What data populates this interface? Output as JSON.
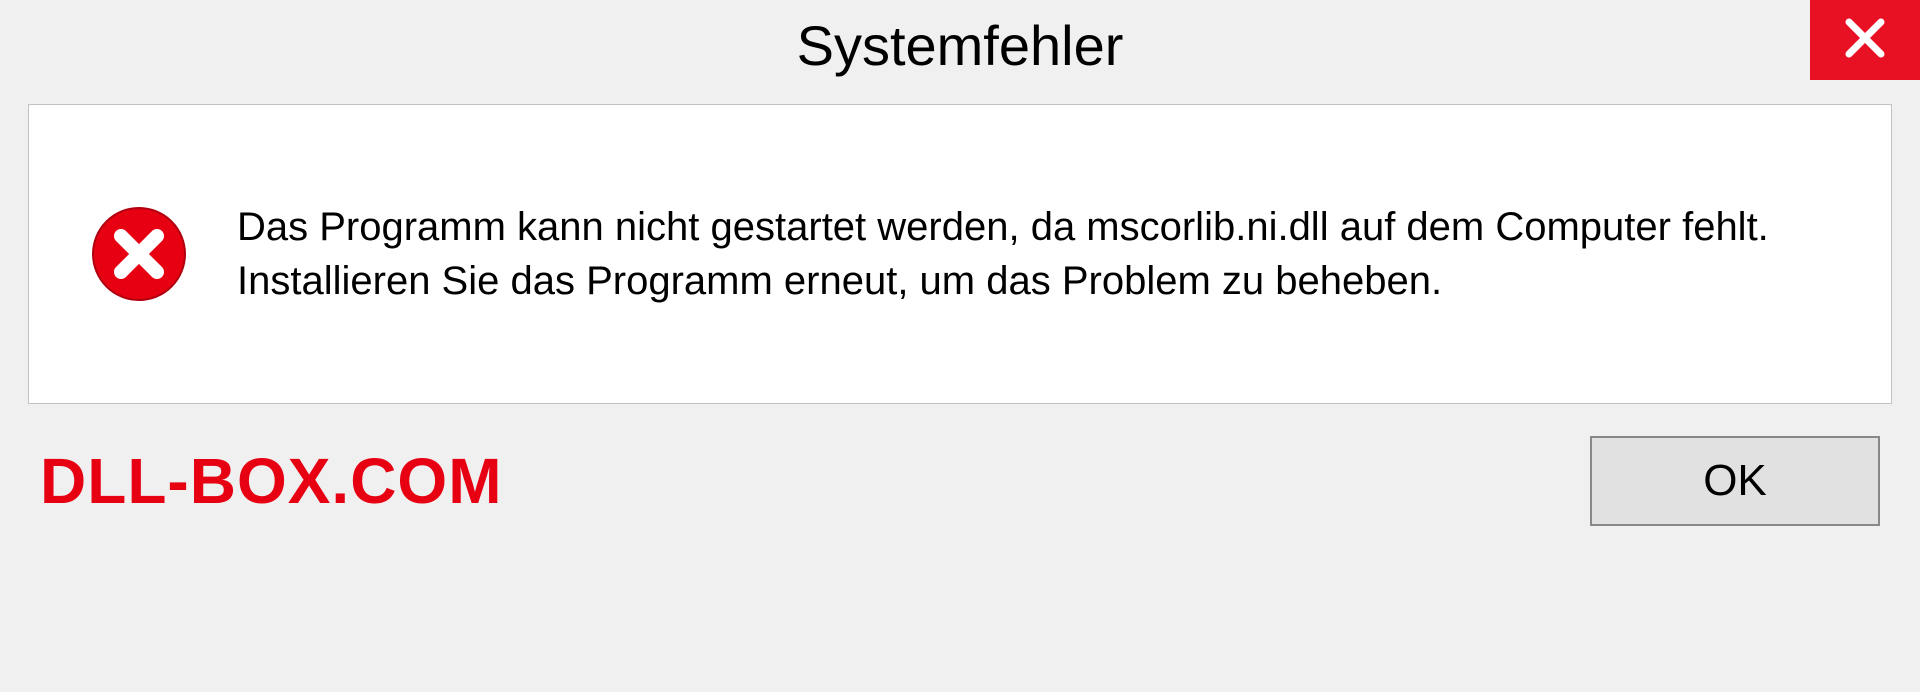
{
  "dialog": {
    "title": "Systemfehler",
    "message": "Das Programm kann nicht gestartet werden, da mscorlib.ni.dll auf dem Computer fehlt. Installieren Sie das Programm erneut, um das Problem zu beheben.",
    "ok_label": "OK"
  },
  "watermark": "DLL-BOX.COM"
}
